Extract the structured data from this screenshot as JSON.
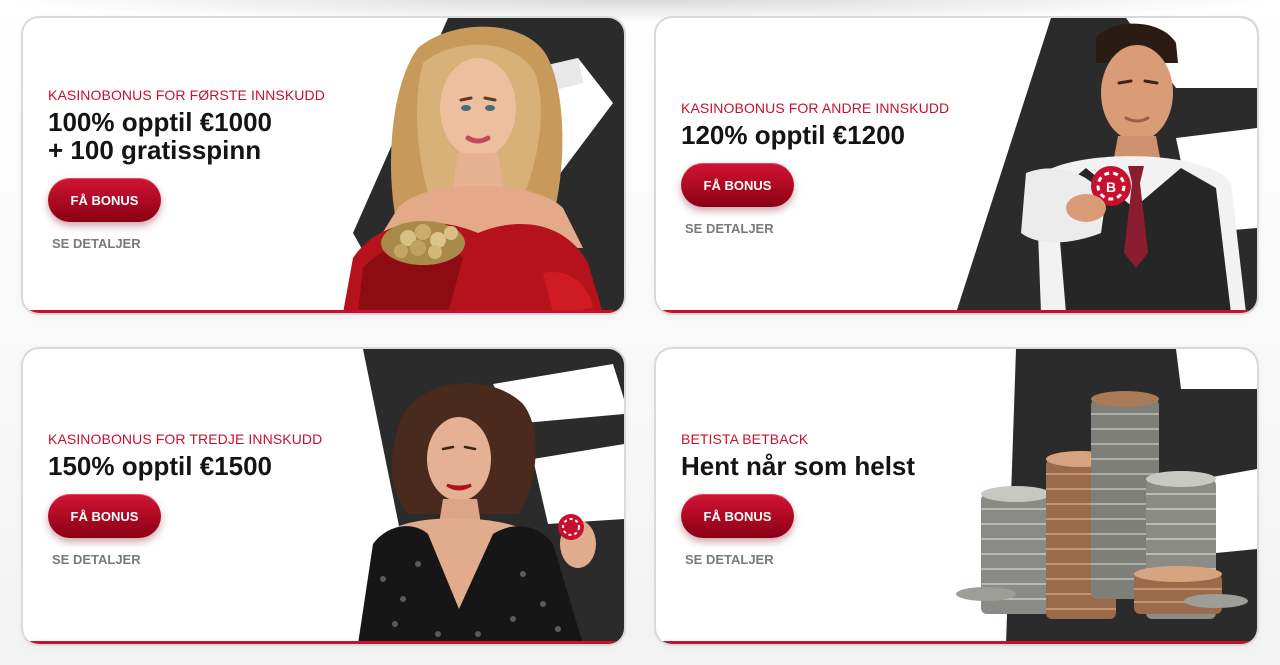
{
  "promotions": [
    {
      "eyebrow": "KASINOBONUS FOR FØRSTE INNSKUDD",
      "headline_line1": "100% opptil €1000",
      "headline_line2": "+ 100 gratisspinn",
      "cta_label": "FÅ BONUS",
      "details_label": "SE DETALJER",
      "illustration": "woman-red-dress-holding-coins"
    },
    {
      "eyebrow": "KASINOBONUS FOR ANDRE INNSKUDD",
      "headline_line1": "120% opptil €1200",
      "cta_label": "FÅ BONUS",
      "details_label": "SE DETALJER",
      "illustration": "dealer-man-holding-casino-chip"
    },
    {
      "eyebrow": "KASINOBONUS FOR TREDJE INNSKUDD",
      "headline_line1": "150% opptil €1500",
      "cta_label": "FÅ BONUS",
      "details_label": "SE DETALJER",
      "illustration": "woman-sequin-dress-holding-chip"
    },
    {
      "eyebrow": "BETISTA BETBACK",
      "headline_line1": "Hent når som helst",
      "cta_label": "FÅ BONUS",
      "details_label": "SE DETALJER",
      "illustration": "stacks-of-coins"
    }
  ],
  "colors": {
    "accent": "#c8102e",
    "headline": "#141414",
    "dark_panel": "#2b2b2b",
    "details": "#7a7a7a"
  }
}
